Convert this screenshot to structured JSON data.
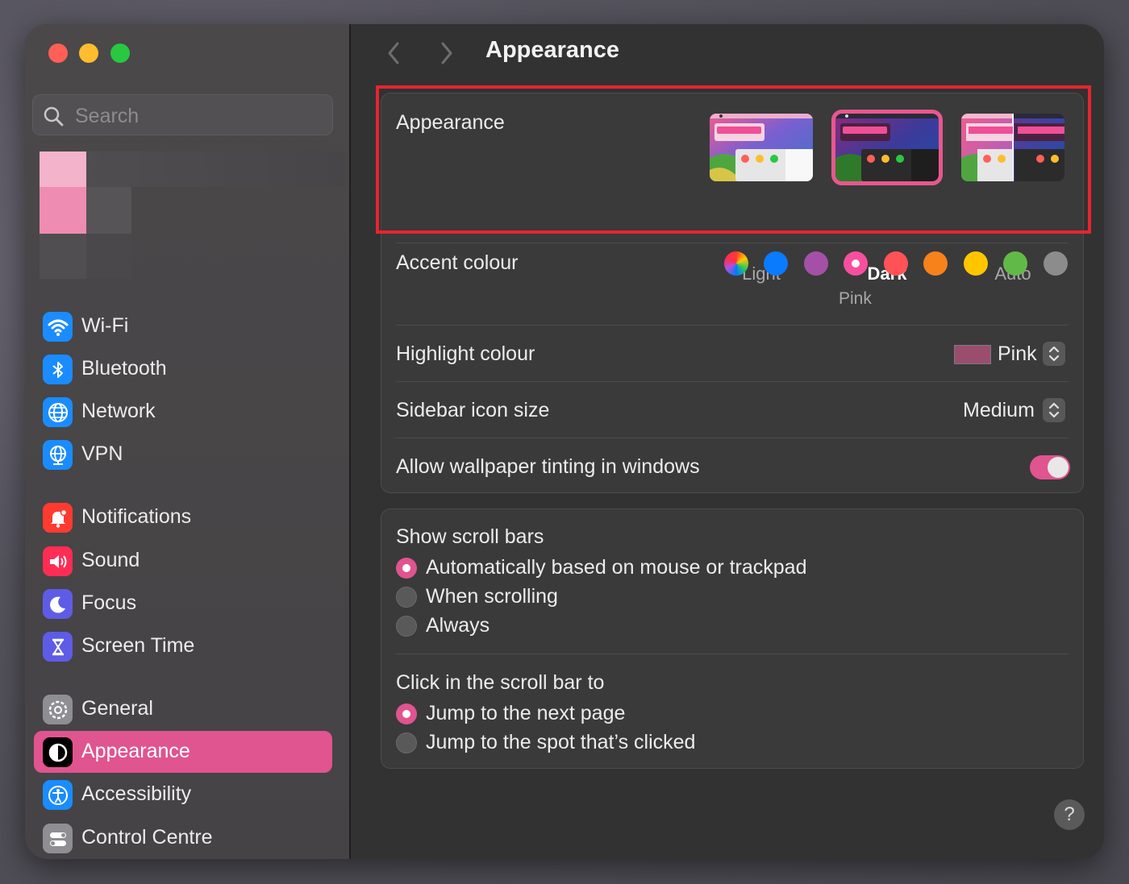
{
  "window_controls": {
    "close": "close-button",
    "minimize": "minimize-button",
    "zoom": "zoom-button"
  },
  "search": {
    "placeholder": "Search",
    "value": ""
  },
  "sidebar": {
    "items": [
      {
        "label": "Wi-Fi",
        "icon": "wifi-icon",
        "color": "#1a8cff"
      },
      {
        "label": "Bluetooth",
        "icon": "bluetooth-icon",
        "color": "#1a8cff"
      },
      {
        "label": "Network",
        "icon": "globe-icon",
        "color": "#1a8cff"
      },
      {
        "label": "VPN",
        "icon": "vpn-globe-icon",
        "color": "#1a8cff"
      },
      {
        "label": "Notifications",
        "icon": "bell-icon",
        "color": "#ff3b30"
      },
      {
        "label": "Sound",
        "icon": "speaker-icon",
        "color": "#ff2d55"
      },
      {
        "label": "Focus",
        "icon": "moon-icon",
        "color": "#5e5ce6"
      },
      {
        "label": "Screen Time",
        "icon": "hourglass-icon",
        "color": "#5e5ce6"
      },
      {
        "label": "General",
        "icon": "gear-icon",
        "color": "#8e8e93"
      },
      {
        "label": "Appearance",
        "icon": "appearance-icon",
        "color": "#000000",
        "selected": true
      },
      {
        "label": "Accessibility",
        "icon": "accessibility-icon",
        "color": "#1a8cff"
      },
      {
        "label": "Control Centre",
        "icon": "control-centre-icon",
        "color": "#8e8e93"
      }
    ]
  },
  "header": {
    "title": "Appearance"
  },
  "appearance_section": {
    "label": "Appearance",
    "options": [
      {
        "label": "Light",
        "selected": false
      },
      {
        "label": "Dark",
        "selected": true
      },
      {
        "label": "Auto",
        "selected": false
      }
    ]
  },
  "accent": {
    "label": "Accent colour",
    "selected_name": "Pink",
    "colors": [
      "multicolor",
      "#0a7aff",
      "#a550a7",
      "#f74f9e",
      "#ff5257",
      "#f7821b",
      "#ffc600",
      "#62ba46",
      "#8c8c8c"
    ]
  },
  "highlight": {
    "label": "Highlight colour",
    "value": "Pink",
    "swatch": "#9b4d6e"
  },
  "sidebar_icon_size": {
    "label": "Sidebar icon size",
    "value": "Medium"
  },
  "wallpaper_tinting": {
    "label": "Allow wallpaper tinting in windows",
    "enabled": true
  },
  "scroll_bars": {
    "label": "Show scroll bars",
    "options": [
      {
        "label": "Automatically based on mouse or trackpad",
        "selected": true
      },
      {
        "label": "When scrolling",
        "selected": false
      },
      {
        "label": "Always",
        "selected": false
      }
    ]
  },
  "click_scroll": {
    "label": "Click in the scroll bar to",
    "options": [
      {
        "label": "Jump to the next page",
        "selected": true
      },
      {
        "label": "Jump to the spot that’s clicked",
        "selected": false
      }
    ]
  },
  "help": {
    "label": "?"
  },
  "colors": {
    "accent": "#e0548f",
    "annotation_red": "#e8242f"
  }
}
